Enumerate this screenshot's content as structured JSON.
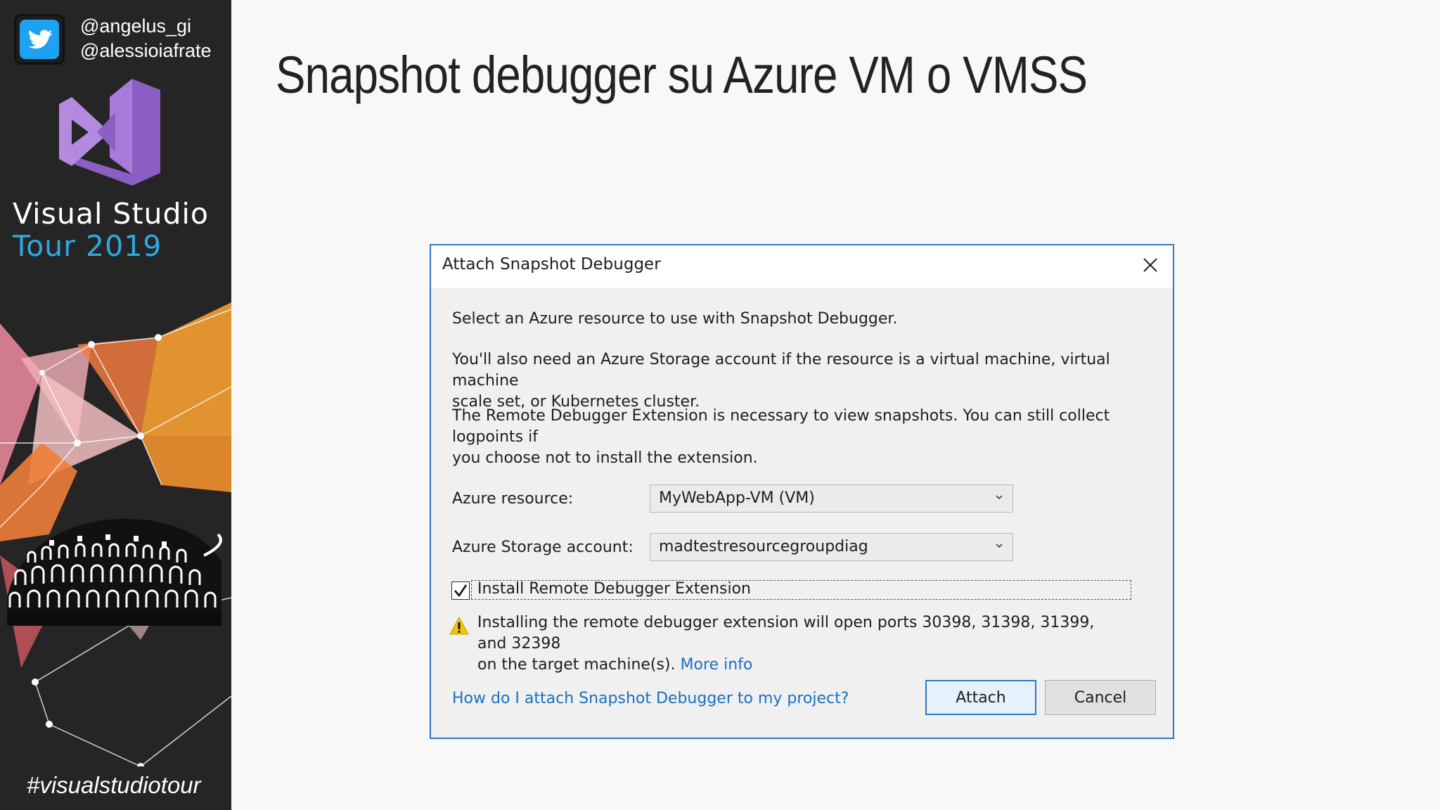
{
  "sidebar": {
    "twitter_handles": [
      "@angelus_gi",
      "@alessioiafrate"
    ],
    "event_title": "Visual Studio",
    "event_subtitle": "Tour 2019",
    "hashtag": "#visualstudiotour",
    "colors": {
      "background": "#252526",
      "accent": "#2fa8e0",
      "logo_purple": "#8b5ec4",
      "twitter_blue": "#1da1f2"
    }
  },
  "slide": {
    "title": "Snapshot debugger su Azure VM o VMSS"
  },
  "dialog": {
    "title": "Attach Snapshot Debugger",
    "intro": "Select an Azure resource to use with Snapshot Debugger.",
    "storage_note_line1": "You'll also need an Azure Storage account if the resource is a virtual machine, virtual machine",
    "storage_note_line2": "scale set, or Kubernetes cluster.",
    "extension_note_line1": "The Remote Debugger Extension is necessary to view snapshots. You can still collect logpoints if",
    "extension_note_line2": "you choose not to install the extension.",
    "azure_resource_label": "Azure resource:",
    "azure_resource_value": "MyWebApp-VM (VM)",
    "storage_account_label": "Azure Storage account:",
    "storage_account_value": "madtestresourcegroupdiag",
    "install_extension_label": "Install Remote Debugger Extension",
    "install_extension_checked": true,
    "warning_line1": "Installing the remote debugger extension will open ports 30398, 31398, 31399, and 32398",
    "warning_line2_prefix": "on the target machine(s).",
    "more_info_link": "More info",
    "help_link": "How do I attach Snapshot Debugger to my project?",
    "attach_button": "Attach",
    "cancel_button": "Cancel",
    "colors": {
      "border": "#2b79c7",
      "link": "#1a6fc4",
      "warning": "#f5c400"
    }
  }
}
